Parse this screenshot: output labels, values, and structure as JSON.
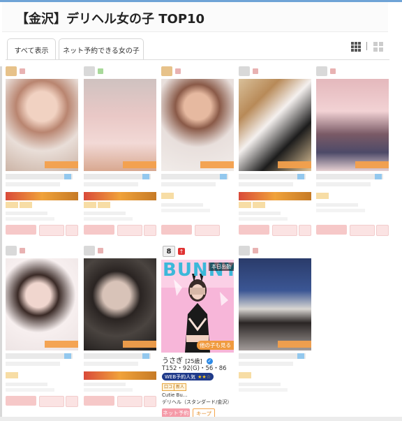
{
  "header": {
    "title": "【金沢】デリヘル女の子 TOP10"
  },
  "tabs": [
    {
      "label": "すべて表示"
    },
    {
      "label": "ネット予約できる女の子"
    }
  ],
  "view_toggle": {
    "grid_icon": "grid-view-icon",
    "large_icon": "large-grid-icon"
  },
  "featured": {
    "rank": "8",
    "rank_change": "↑",
    "photo_banner": "BUNNY",
    "attendance": "本日出勤",
    "more_link": "他の子も見る",
    "name": "うさぎ",
    "age": "[25歳]",
    "measurements": "T152・92(G)・56・86",
    "web_badge": "WEB予約人気",
    "stars": "★★☆",
    "chips": [
      "口コミ",
      "新人"
    ],
    "shop": "Cutie Bu...",
    "category": "デリヘル（スタンダード/金沢）",
    "net_button": "ネット予約",
    "keep_button": "キープ"
  },
  "colors": {
    "accent_orange": "#f3a04c",
    "accent_pink": "#f59aa8",
    "web_badge": "#1f3a8a",
    "verified_blue": "#2e8be6"
  }
}
